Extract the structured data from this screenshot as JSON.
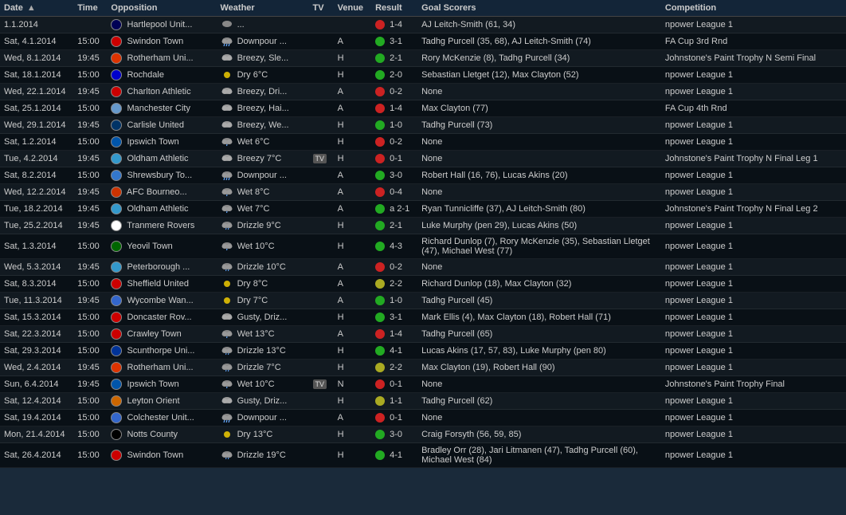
{
  "columns": [
    {
      "key": "date",
      "label": "Date",
      "sortable": true
    },
    {
      "key": "time",
      "label": "Time",
      "sortable": false
    },
    {
      "key": "opposition",
      "label": "Opposition",
      "sortable": false
    },
    {
      "key": "weather",
      "label": "Weather",
      "sortable": false
    },
    {
      "key": "tv",
      "label": "TV",
      "sortable": false
    },
    {
      "key": "venue",
      "label": "Venue",
      "sortable": false
    },
    {
      "key": "result",
      "label": "Result",
      "sortable": false
    },
    {
      "key": "goalscorers",
      "label": "Goal Scorers",
      "sortable": false
    },
    {
      "key": "competition",
      "label": "Competition",
      "sortable": false
    }
  ],
  "rows": [
    {
      "date": "1.1.2014",
      "time": "",
      "opposition": "Hartlepool Unit...",
      "weather": "...",
      "tv": "",
      "venue": "",
      "result": "1-4",
      "result_type": "loss",
      "goalscorers": "AJ Leitch-Smith (61, 34)",
      "competition": "npower League 1"
    },
    {
      "date": "Sat, 4.1.2014",
      "time": "15:00",
      "opposition": "Swindon Town",
      "weather": "Downpour ...",
      "tv": "",
      "venue": "A",
      "result": "3-1",
      "result_type": "win",
      "goalscorers": "Tadhg Purcell (35, 68), AJ Leitch-Smith (74)",
      "competition": "FA Cup 3rd Rnd"
    },
    {
      "date": "Wed, 8.1.2014",
      "time": "19:45",
      "opposition": "Rotherham Uni...",
      "weather": "Breezy, Sle...",
      "tv": "",
      "venue": "H",
      "result": "2-1",
      "result_type": "win",
      "goalscorers": "Rory McKenzie (8), Tadhg Purcell (34)",
      "competition": "Johnstone's Paint Trophy N Semi Final"
    },
    {
      "date": "Sat, 18.1.2014",
      "time": "15:00",
      "opposition": "Rochdale",
      "weather": "Dry 6°C",
      "tv": "",
      "venue": "H",
      "result": "2-0",
      "result_type": "win",
      "goalscorers": "Sebastian Lletget (12), Max Clayton (52)",
      "competition": "npower League 1"
    },
    {
      "date": "Wed, 22.1.2014",
      "time": "19:45",
      "opposition": "Charlton Athletic",
      "weather": "Breezy, Dri...",
      "tv": "",
      "venue": "A",
      "result": "0-2",
      "result_type": "loss",
      "goalscorers": "None",
      "competition": "npower League 1"
    },
    {
      "date": "Sat, 25.1.2014",
      "time": "15:00",
      "opposition": "Manchester City",
      "weather": "Breezy, Hai...",
      "tv": "",
      "venue": "A",
      "result": "1-4",
      "result_type": "loss",
      "goalscorers": "Max Clayton (77)",
      "competition": "FA Cup 4th Rnd"
    },
    {
      "date": "Wed, 29.1.2014",
      "time": "19:45",
      "opposition": "Carlisle United",
      "weather": "Breezy, We...",
      "tv": "",
      "venue": "H",
      "result": "1-0",
      "result_type": "win",
      "goalscorers": "Tadhg Purcell (73)",
      "competition": "npower League 1"
    },
    {
      "date": "Sat, 1.2.2014",
      "time": "15:00",
      "opposition": "Ipswich Town",
      "weather": "Wet 6°C",
      "tv": "",
      "venue": "H",
      "result": "0-2",
      "result_type": "loss",
      "goalscorers": "None",
      "competition": "npower League 1"
    },
    {
      "date": "Tue, 4.2.2014",
      "time": "19:45",
      "opposition": "Oldham Athletic",
      "weather": "Breezy 7°C",
      "tv": "TV",
      "venue": "H",
      "result": "0-1",
      "result_type": "loss",
      "goalscorers": "None",
      "competition": "Johnstone's Paint Trophy N Final Leg 1"
    },
    {
      "date": "Sat, 8.2.2014",
      "time": "15:00",
      "opposition": "Shrewsbury To...",
      "weather": "Downpour ...",
      "tv": "",
      "venue": "A",
      "result": "3-0",
      "result_type": "win",
      "goalscorers": "Robert Hall (16, 76), Lucas Akins (20)",
      "competition": "npower League 1"
    },
    {
      "date": "Wed, 12.2.2014",
      "time": "19:45",
      "opposition": "AFC Bourneo...",
      "weather": "Wet 8°C",
      "tv": "",
      "venue": "A",
      "result": "0-4",
      "result_type": "loss",
      "goalscorers": "None",
      "competition": "npower League 1"
    },
    {
      "date": "Tue, 18.2.2014",
      "time": "19:45",
      "opposition": "Oldham Athletic",
      "weather": "Wet 7°C",
      "tv": "",
      "venue": "A",
      "result": "a 2-1",
      "result_type": "win",
      "goalscorers": "Ryan Tunnicliffe (37), AJ Leitch-Smith (80)",
      "competition": "Johnstone's Paint Trophy N Final Leg 2"
    },
    {
      "date": "Tue, 25.2.2014",
      "time": "19:45",
      "opposition": "Tranmere Rovers",
      "weather": "Drizzle 9°C",
      "tv": "",
      "venue": "H",
      "result": "2-1",
      "result_type": "win",
      "goalscorers": "Luke Murphy (pen 29), Lucas Akins (50)",
      "competition": "npower League 1"
    },
    {
      "date": "Sat, 1.3.2014",
      "time": "15:00",
      "opposition": "Yeovil Town",
      "weather": "Wet 10°C",
      "tv": "",
      "venue": "H",
      "result": "4-3",
      "result_type": "win",
      "goalscorers": "Richard Dunlop (7), Rory McKenzie (35), Sebastian Lletget (47), Michael West (77)",
      "competition": "npower League 1"
    },
    {
      "date": "Wed, 5.3.2014",
      "time": "19:45",
      "opposition": "Peterborough ...",
      "weather": "Drizzle 10°C",
      "tv": "",
      "venue": "A",
      "result": "0-2",
      "result_type": "loss",
      "goalscorers": "None",
      "competition": "npower League 1"
    },
    {
      "date": "Sat, 8.3.2014",
      "time": "15:00",
      "opposition": "Sheffield United",
      "weather": "Dry 8°C",
      "tv": "",
      "venue": "A",
      "result": "2-2",
      "result_type": "draw",
      "goalscorers": "Richard Dunlop (18), Max Clayton (32)",
      "competition": "npower League 1"
    },
    {
      "date": "Tue, 11.3.2014",
      "time": "19:45",
      "opposition": "Wycombe Wan...",
      "weather": "Dry 7°C",
      "tv": "",
      "venue": "A",
      "result": "1-0",
      "result_type": "win",
      "goalscorers": "Tadhg Purcell (45)",
      "competition": "npower League 1"
    },
    {
      "date": "Sat, 15.3.2014",
      "time": "15:00",
      "opposition": "Doncaster Rov...",
      "weather": "Gusty, Driz...",
      "tv": "",
      "venue": "H",
      "result": "3-1",
      "result_type": "win",
      "goalscorers": "Mark Ellis (4), Max Clayton (18), Robert Hall (71)",
      "competition": "npower League 1"
    },
    {
      "date": "Sat, 22.3.2014",
      "time": "15:00",
      "opposition": "Crawley Town",
      "weather": "Wet 13°C",
      "tv": "",
      "venue": "A",
      "result": "1-4",
      "result_type": "loss",
      "goalscorers": "Tadhg Purcell (65)",
      "competition": "npower League 1"
    },
    {
      "date": "Sat, 29.3.2014",
      "time": "15:00",
      "opposition": "Scunthorpe Uni...",
      "weather": "Drizzle 13°C",
      "tv": "",
      "venue": "H",
      "result": "4-1",
      "result_type": "win",
      "goalscorers": "Lucas Akins (17, 57, 83), Luke Murphy (pen 80)",
      "competition": "npower League 1"
    },
    {
      "date": "Wed, 2.4.2014",
      "time": "19:45",
      "opposition": "Rotherham Uni...",
      "weather": "Drizzle 7°C",
      "tv": "",
      "venue": "H",
      "result": "2-2",
      "result_type": "draw",
      "goalscorers": "Max Clayton (19), Robert Hall (90)",
      "competition": "npower League 1"
    },
    {
      "date": "Sun, 6.4.2014",
      "time": "19:45",
      "opposition": "Ipswich Town",
      "weather": "Wet 10°C",
      "tv": "TV",
      "venue": "N",
      "result": "0-1",
      "result_type": "loss",
      "goalscorers": "None",
      "competition": "Johnstone's Paint Trophy Final"
    },
    {
      "date": "Sat, 12.4.2014",
      "time": "15:00",
      "opposition": "Leyton Orient",
      "weather": "Gusty, Driz...",
      "tv": "",
      "venue": "H",
      "result": "1-1",
      "result_type": "draw",
      "goalscorers": "Tadhg Purcell (62)",
      "competition": "npower League 1"
    },
    {
      "date": "Sat, 19.4.2014",
      "time": "15:00",
      "opposition": "Colchester Unit...",
      "weather": "Downpour ...",
      "tv": "",
      "venue": "A",
      "result": "0-1",
      "result_type": "loss",
      "goalscorers": "None",
      "competition": "npower League 1"
    },
    {
      "date": "Mon, 21.4.2014",
      "time": "15:00",
      "opposition": "Notts County",
      "weather": "Dry 13°C",
      "tv": "",
      "venue": "H",
      "result": "3-0",
      "result_type": "win",
      "goalscorers": "Craig Forsyth (56, 59, 85)",
      "competition": "npower League 1"
    },
    {
      "date": "Sat, 26.4.2014",
      "time": "15:00",
      "opposition": "Swindon Town",
      "weather": "Drizzle 19°C",
      "tv": "",
      "venue": "H",
      "result": "4-1",
      "result_type": "win",
      "goalscorers": "Bradley Orr (28), Jari Litmanen (47), Tadhg Purcell (60), Michael West (84)",
      "competition": "npower League 1"
    }
  ]
}
